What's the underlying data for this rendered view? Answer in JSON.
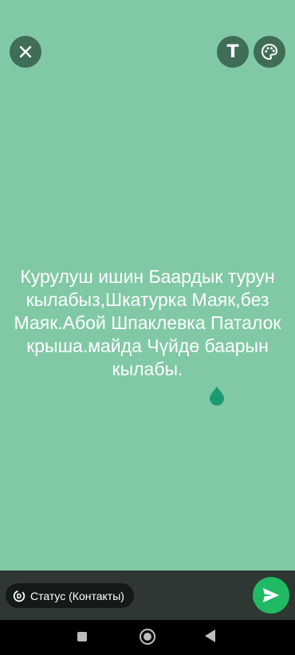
{
  "theme": {
    "background_color": "#80c9a4",
    "accent_color": "#1fba63",
    "cursor_color": "#1a9b72"
  },
  "toolbar": {
    "close_icon": "close-icon",
    "text_tool_label": "T",
    "palette_icon": "palette-icon"
  },
  "status": {
    "text": "Курулуш ишин Баардык турун кылабыз,Шкатурка Маяк,без Маяк.Абой Шпаклевка Паталок крыша.майда Чүйдө баарын кылабы."
  },
  "bottom_bar": {
    "audience_label": "Статус (Контакты)",
    "audience_icon": "privacy-icon",
    "send_icon": "send-icon"
  },
  "nav": {
    "recents_icon": "recents-icon",
    "home_icon": "home-icon",
    "back_icon": "back-icon"
  }
}
